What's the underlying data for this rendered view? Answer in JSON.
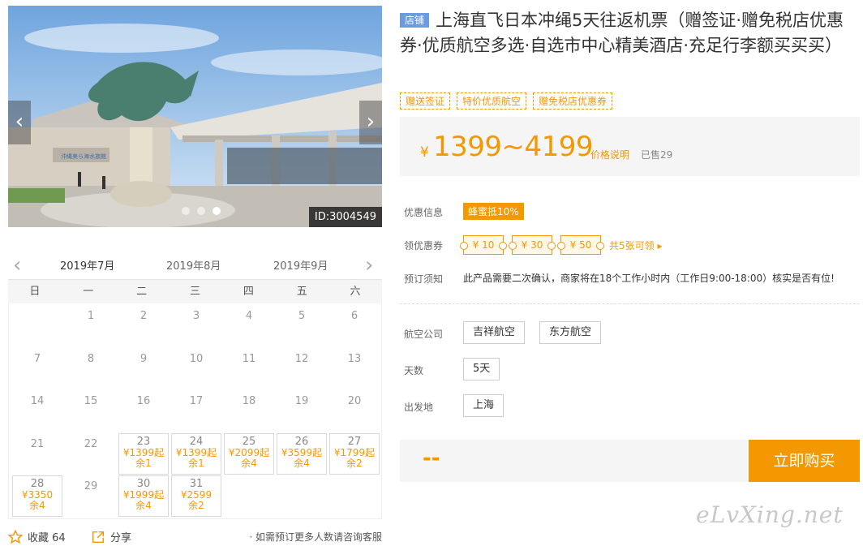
{
  "gallery": {
    "image_id": "ID:3004549",
    "prev_glyph": "‹",
    "next_glyph": "›",
    "sign_text": "沖縄美ら海水族館",
    "dots": 3,
    "active_dot": 3
  },
  "calendar": {
    "prev_glyph": "‹",
    "next_glyph": "›",
    "months": [
      "2019年7月",
      "2019年8月",
      "2019年9月"
    ],
    "active_month": 0,
    "weekdays": [
      "日",
      "一",
      "二",
      "三",
      "四",
      "五",
      "六"
    ],
    "days": [
      {
        "d": "1"
      },
      {
        "d": "2"
      },
      {
        "d": "3"
      },
      {
        "d": "4"
      },
      {
        "d": "5"
      },
      {
        "d": "6"
      },
      {
        "d": "7"
      },
      {
        "d": "8"
      },
      {
        "d": "9"
      },
      {
        "d": "10"
      },
      {
        "d": "11"
      },
      {
        "d": "12"
      },
      {
        "d": "13"
      },
      {
        "d": "14"
      },
      {
        "d": "15"
      },
      {
        "d": "16"
      },
      {
        "d": "17"
      },
      {
        "d": "18"
      },
      {
        "d": "19"
      },
      {
        "d": "20"
      },
      {
        "d": "21"
      },
      {
        "d": "22"
      },
      {
        "d": "23",
        "price": "¥1399起",
        "stock": "余1"
      },
      {
        "d": "24",
        "price": "¥1399起",
        "stock": "余1"
      },
      {
        "d": "25",
        "price": "¥2099起",
        "stock": "余4"
      },
      {
        "d": "26",
        "price": "¥3599起",
        "stock": "余4"
      },
      {
        "d": "27",
        "price": "¥1799起",
        "stock": "余2"
      },
      {
        "d": "28",
        "price": "¥3350",
        "stock": "余4"
      },
      {
        "d": "29"
      },
      {
        "d": "30",
        "price": "¥1999起",
        "stock": "余4"
      },
      {
        "d": "31",
        "price": "¥2599",
        "stock": "余2"
      }
    ]
  },
  "footer": {
    "favorite_label": "收藏 64",
    "share_label": "分享",
    "note": "· 如需预订更多人数请咨询客服"
  },
  "product": {
    "shop_badge": "店铺",
    "title": "上海直飞日本冲绳5天往返机票（赠签证·赠免税店优惠券·优质航空多选·自选市中心精美酒店·充足行李额买买买）",
    "tags": [
      "赠送签证",
      "特价优质航空",
      "赠免税店优惠券"
    ]
  },
  "price": {
    "currency": "¥",
    "range": "1399~4199",
    "explain_label": "价格说明",
    "sold": "已售29"
  },
  "info": {
    "promo_label": "优惠信息",
    "promo_value": "蜂蜜抵10%",
    "coupon_label": "领优惠券",
    "coupons": [
      "¥ 10",
      "¥ 30",
      "¥ 50"
    ],
    "coupon_more": "共5张可领 ▸",
    "notice_label": "预订须知",
    "notice_text": "此产品需要二次确认，商家将在18个工作小时内（工作日9:00-18:00）核实是否有位!"
  },
  "options": {
    "airline_label": "航空公司",
    "airlines": [
      "吉祥航空",
      "东方航空"
    ],
    "days_label": "天数",
    "days_value": "5天",
    "departure_label": "出发地",
    "departure_value": "上海"
  },
  "buy": {
    "total_placeholder": "--",
    "button_label": "立即购买"
  },
  "watermark": "eLvXing.net",
  "colors": {
    "accent": "#f39800",
    "badge_blue": "#6b9be0",
    "panel_gray": "#f5f5f5"
  }
}
